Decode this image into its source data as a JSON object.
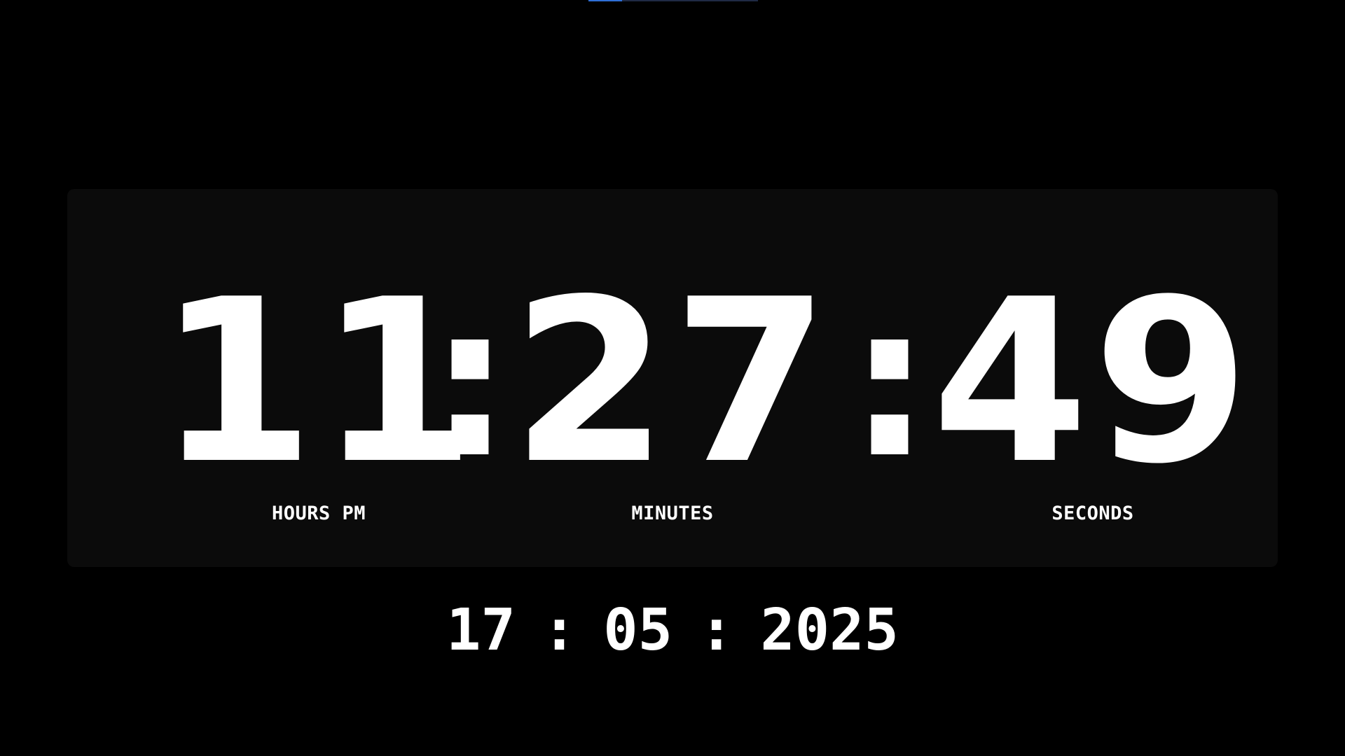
{
  "colors": {
    "background": "#000000",
    "panel": "#0b0b0b",
    "text": "#ffffff",
    "accent": "#2f6fd6"
  },
  "top_indicator": {
    "progress": 0.2
  },
  "clock": {
    "hours": "11",
    "minutes": "27",
    "seconds": "49",
    "separator": ":",
    "hours_label": "HOURS PM",
    "minutes_label": "MINUTES",
    "seconds_label": "SECONDS"
  },
  "date": {
    "day": "17",
    "month": "05",
    "year": "2025",
    "separator": ":"
  }
}
